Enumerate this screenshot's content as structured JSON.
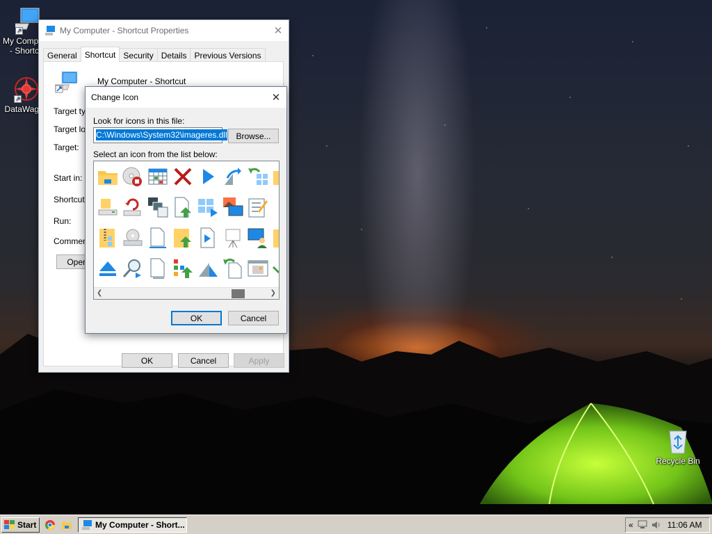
{
  "desktop": {
    "icons": [
      {
        "label": "My Computer - Shortcut",
        "icon": "computer-icon"
      },
      {
        "label": "DataWagon",
        "icon": "datawagon-icon"
      },
      {
        "label": "Recycle Bin",
        "icon": "recycle-bin-icon"
      }
    ]
  },
  "properties_window": {
    "title": "My Computer - Shortcut Properties",
    "tabs": [
      "General",
      "Shortcut",
      "Security",
      "Details",
      "Previous Versions"
    ],
    "active_tab": "Shortcut",
    "shortcut_name": "My Computer - Shortcut",
    "labels": {
      "target_type": "Target typ",
      "target_location": "Target loc",
      "target": "Target:",
      "start_in": "Start in:",
      "shortcut_key": "Shortcut k",
      "run": "Run:",
      "comment": "Comment:"
    },
    "open_button": "Open",
    "buttons": {
      "ok": "OK",
      "cancel": "Cancel",
      "apply": "Apply"
    }
  },
  "change_icon_dialog": {
    "title": "Change Icon",
    "file_label": "Look for icons in this file:",
    "file_value": "C:\\Windows\\System32\\imageres.dll",
    "browse_button": "Browse...",
    "list_label": "Select an icon from the list below:",
    "icons": [
      [
        "folder-icon",
        "disc-stop-icon",
        "calendar-grid-icon",
        "red-x-icon",
        "play-icon",
        "share-arrow-icon",
        "undo-tiles-icon"
      ],
      [
        "drive-icon",
        "refresh-drive-icon",
        "copy-windows-icon",
        "file-upload-icon",
        "tiles-play-icon",
        "picture-monitor-icon",
        "edit-checklist-icon"
      ],
      [
        "zip-folder-icon",
        "optical-drive-icon",
        "blank-document-icon",
        "folder-upload-icon",
        "media-file-icon",
        "projector-icon",
        "user-monitor-icon"
      ],
      [
        "eject-icon",
        "search-icon",
        "text-document-icon",
        "tree-upload-icon",
        "fold-arrow-icon",
        "back-document-icon",
        "image-window-icon"
      ]
    ],
    "buttons": {
      "ok": "OK",
      "cancel": "Cancel"
    }
  },
  "taskbar": {
    "start_label": "Start",
    "task_label": "My Computer - Short...",
    "tray_chevron": "«",
    "clock": "11:06 AM"
  }
}
